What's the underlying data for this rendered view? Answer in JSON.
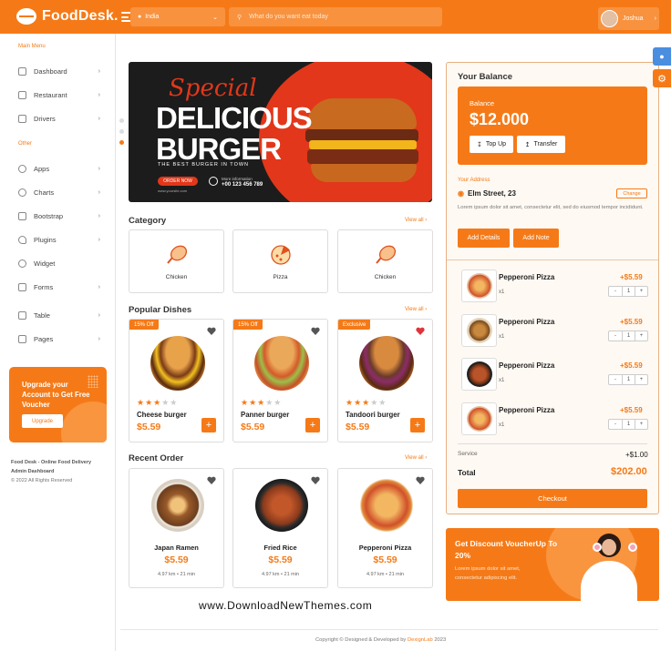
{
  "header": {
    "brand": "FoodDesk.",
    "location": "India",
    "search_placeholder": "What do you want eat today",
    "user": "Joshua"
  },
  "sidebar": {
    "main_menu": "Main Menu",
    "other": "Other",
    "items": [
      {
        "label": "Dashboard"
      },
      {
        "label": "Restaurant"
      },
      {
        "label": "Drivers"
      },
      {
        "label": "Apps"
      },
      {
        "label": "Charts"
      },
      {
        "label": "Bootstrap"
      },
      {
        "label": "Plugins"
      },
      {
        "label": "Widget"
      },
      {
        "label": "Forms"
      },
      {
        "label": "Table"
      },
      {
        "label": "Pages"
      }
    ],
    "upgrade_text": "Upgrade your Account to Get Free Voucher",
    "upgrade_button": "Upgrade",
    "footer_title": "Food Desk - Online Food Delivery Admin Dashboard",
    "footer_copy": "© 2022 All Rights Reserved"
  },
  "banner": {
    "script": "Special",
    "title1": "DELICIOUS",
    "title2": "BURGER",
    "subtitle": "THE BEST BURGER IN TOWN",
    "order": "ORDER NOW",
    "website": "www.yoursite.com",
    "more_info": "More information",
    "phone": "+00 123 456 789"
  },
  "category": {
    "title": "Category",
    "view_all": "View all",
    "items": [
      {
        "label": "Chicken"
      },
      {
        "label": "Pizza"
      },
      {
        "label": "Chicken"
      }
    ]
  },
  "popular": {
    "title": "Popular Dishes",
    "view_all": "View all",
    "items": [
      {
        "badge": "15% Off",
        "name": "Cheese burger",
        "price": "$5.59",
        "rating": 3
      },
      {
        "badge": "15% Off",
        "name": "Panner burger",
        "price": "$5.59",
        "rating": 3
      },
      {
        "badge": "Exclusive",
        "name": "Tandoori burger",
        "price": "$5.59",
        "rating": 3
      }
    ]
  },
  "recent": {
    "title": "Recent Order",
    "view_all": "View all",
    "items": [
      {
        "name": "Japan Ramen",
        "price": "$5.59",
        "distance": "4.97 km",
        "time": "21 min"
      },
      {
        "name": "Fried Rice",
        "price": "$5.59",
        "distance": "4.97 km",
        "time": "21 min"
      },
      {
        "name": "Pepperoni Pizza",
        "price": "$5.59",
        "distance": "4.97 km",
        "time": "21 min"
      }
    ]
  },
  "balance": {
    "title": "Your Balance",
    "label": "Balance",
    "amount": "$12.000",
    "topup": "Top Up",
    "transfer": "Transfer",
    "address_label": "Your Address",
    "address": "Elm Street, 23",
    "change": "Change",
    "address_note": "Lorem ipsum dolor sit amet, consectetur elit, sed do eiusmod tempor incididunt.",
    "add_details": "Add Details",
    "add_note": "Add Note"
  },
  "orders": [
    {
      "name": "Pepperoni Pizza",
      "qty": "x1",
      "price": "+$5.59",
      "count": "1"
    },
    {
      "name": "Pepperoni Pizza",
      "qty": "x1",
      "price": "+$5.59",
      "count": "1"
    },
    {
      "name": "Pepperoni Pizza",
      "qty": "x1",
      "price": "+$5.59",
      "count": "1"
    },
    {
      "name": "Pepperoni Pizza",
      "qty": "x1",
      "price": "+$5.59",
      "count": "1"
    }
  ],
  "stepper": {
    "minus": "-",
    "plus": "+"
  },
  "totals": {
    "service_label": "Service",
    "service": "+$1.00",
    "total_label": "Total",
    "total": "$202.00",
    "checkout": "Checkout"
  },
  "promo": {
    "title": "Get Discount VoucherUp To 20%",
    "text": "Lorem ipsum dolor sit amet, consectetur adipiscing elit."
  },
  "watermark": "www.DownloadNewThemes.com",
  "footer": {
    "copyright": "Copyright © Designed & Developed by",
    "brand": "DexignLab",
    "year": "2023"
  },
  "colors": {
    "accent": "#f57a17",
    "right_tab_blue": "#4a8ee0"
  }
}
